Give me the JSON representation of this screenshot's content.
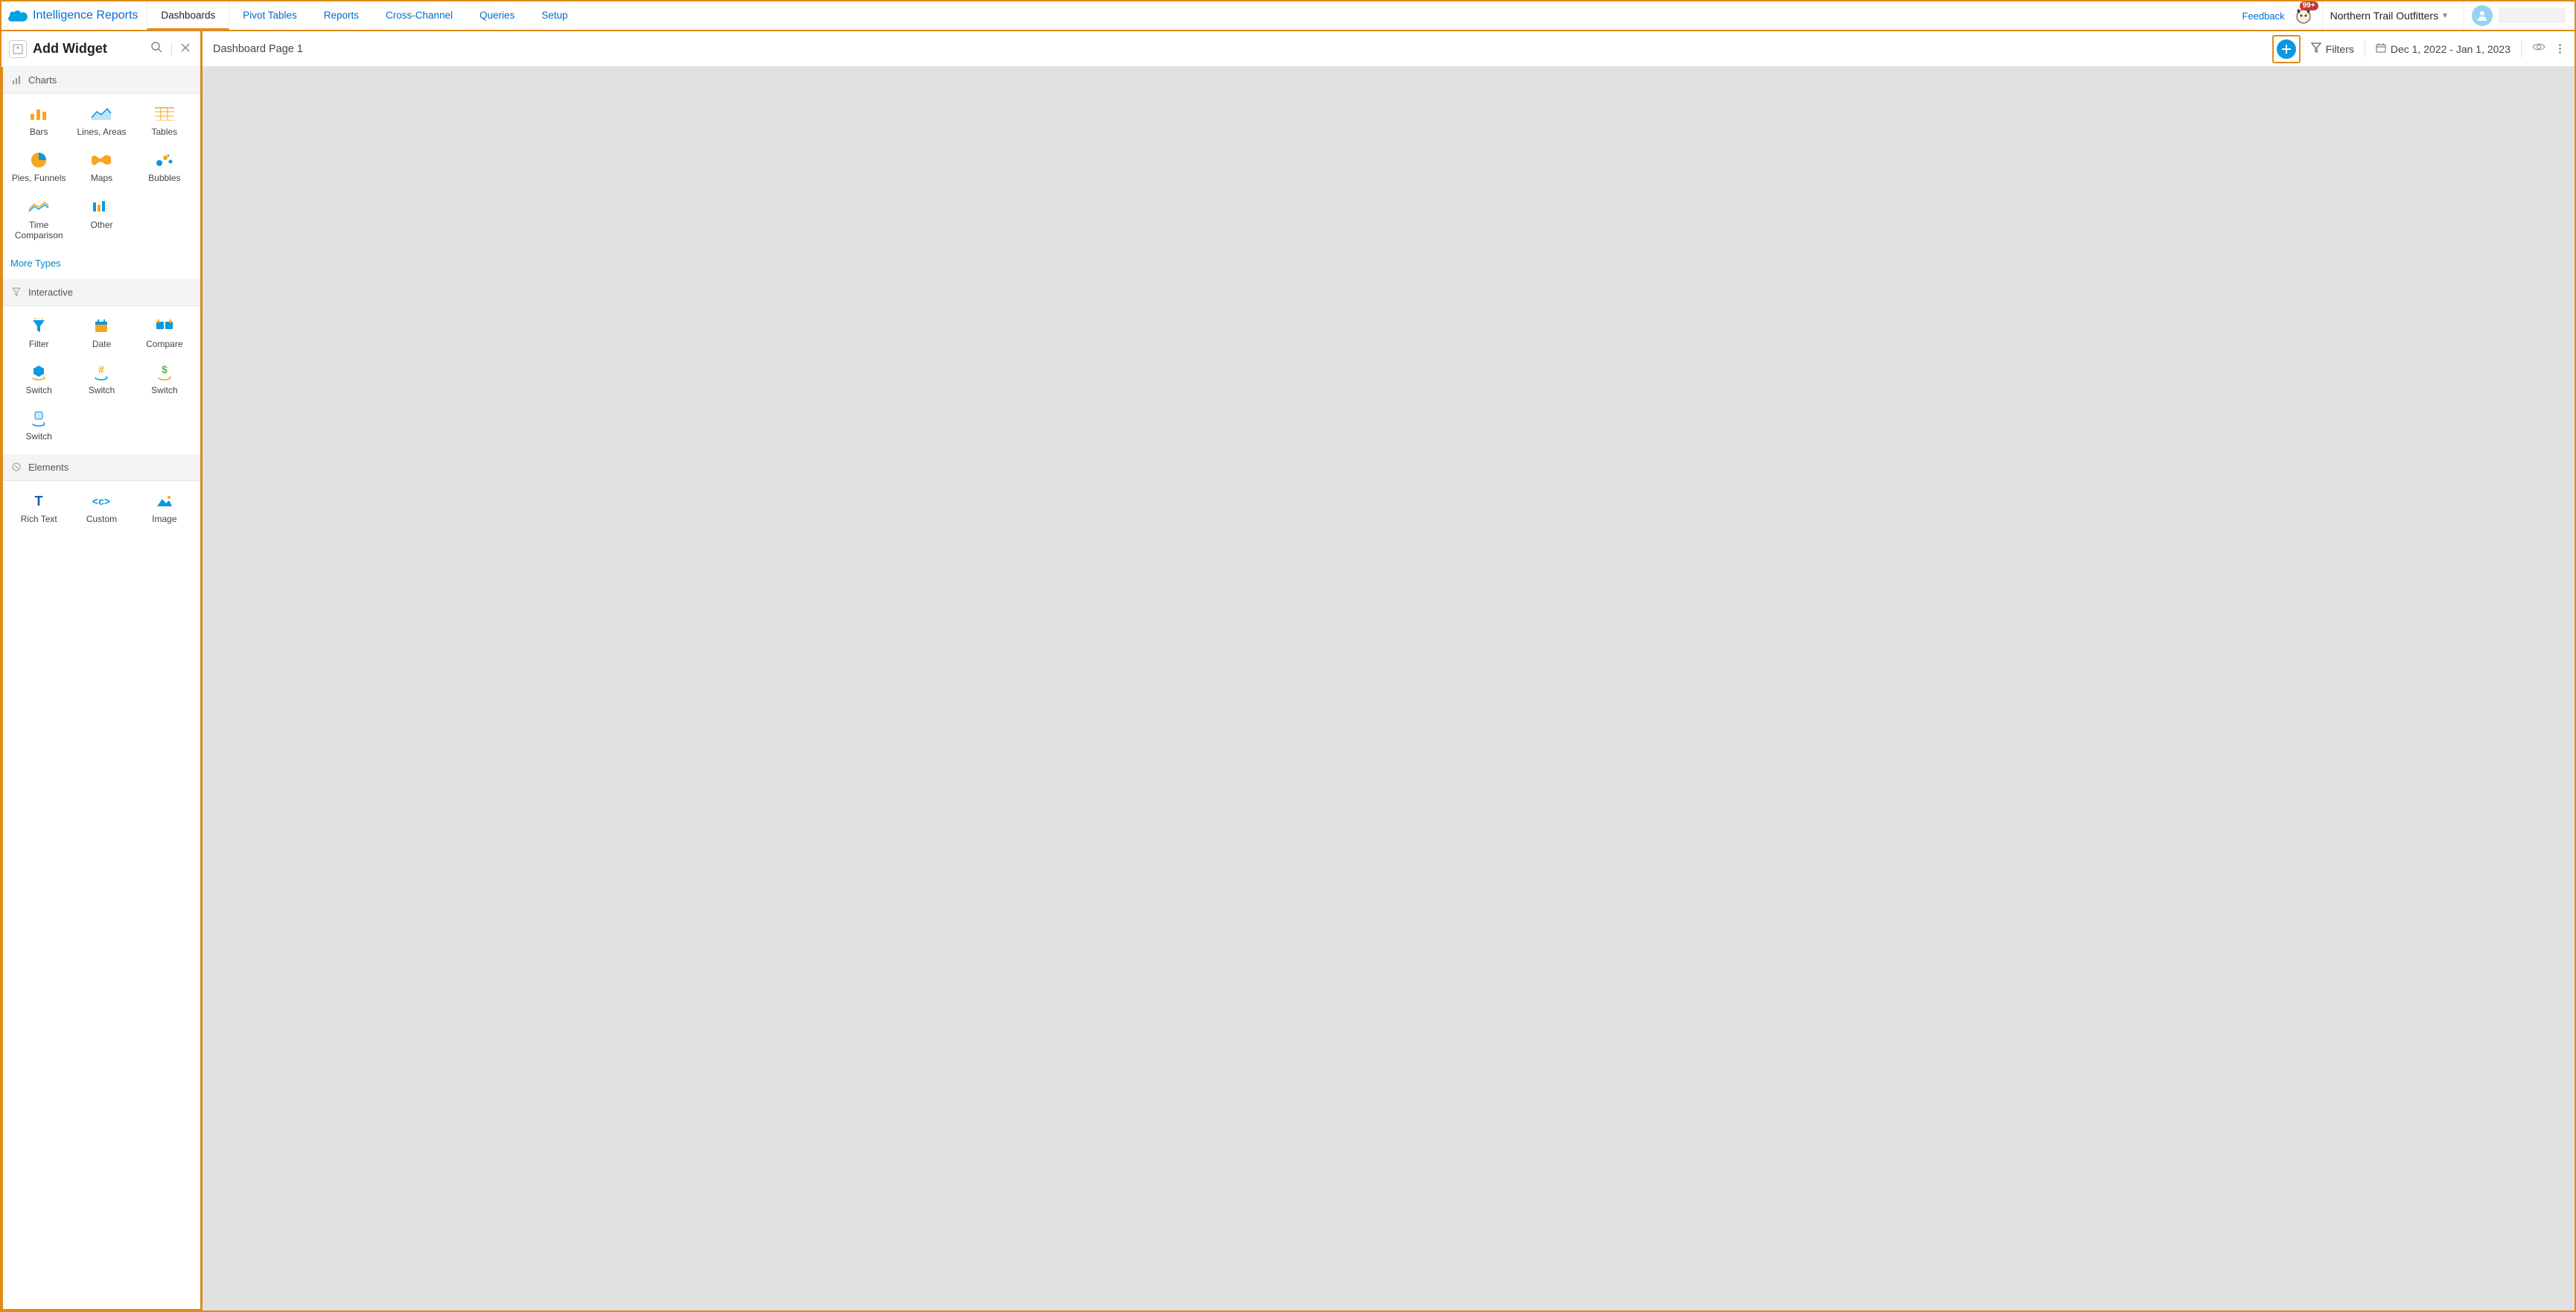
{
  "brand": {
    "title": "Intelligence Reports"
  },
  "nav": {
    "tabs": [
      {
        "label": "Dashboards",
        "active": true
      },
      {
        "label": "Pivot Tables"
      },
      {
        "label": "Reports"
      },
      {
        "label": "Cross-Channel"
      },
      {
        "label": "Queries"
      },
      {
        "label": "Setup"
      }
    ]
  },
  "header_right": {
    "feedback": "Feedback",
    "notifications_badge": "99+",
    "org_name": "Northern Trail Outfitters"
  },
  "sidebar": {
    "title": "Add Widget",
    "sections": {
      "charts": {
        "label": "Charts",
        "items": [
          {
            "label": "Bars"
          },
          {
            "label": "Lines, Areas"
          },
          {
            "label": "Tables"
          },
          {
            "label": "Pies, Funnels"
          },
          {
            "label": "Maps"
          },
          {
            "label": "Bubbles"
          },
          {
            "label": "Time Comparison"
          },
          {
            "label": "Other"
          }
        ],
        "more": "More Types"
      },
      "interactive": {
        "label": "Interactive",
        "items": [
          {
            "label": "Filter"
          },
          {
            "label": "Date"
          },
          {
            "label": "Compare"
          },
          {
            "label": "Switch"
          },
          {
            "label": "Switch"
          },
          {
            "label": "Switch"
          },
          {
            "label": "Switch"
          }
        ]
      },
      "elements": {
        "label": "Elements",
        "items": [
          {
            "label": "Rich Text"
          },
          {
            "label": "Custom"
          },
          {
            "label": "Image"
          }
        ]
      }
    }
  },
  "canvas": {
    "page_name": "Dashboard Page 1",
    "filters_label": "Filters",
    "date_range": "Dec 1, 2022 - Jan 1, 2023"
  }
}
